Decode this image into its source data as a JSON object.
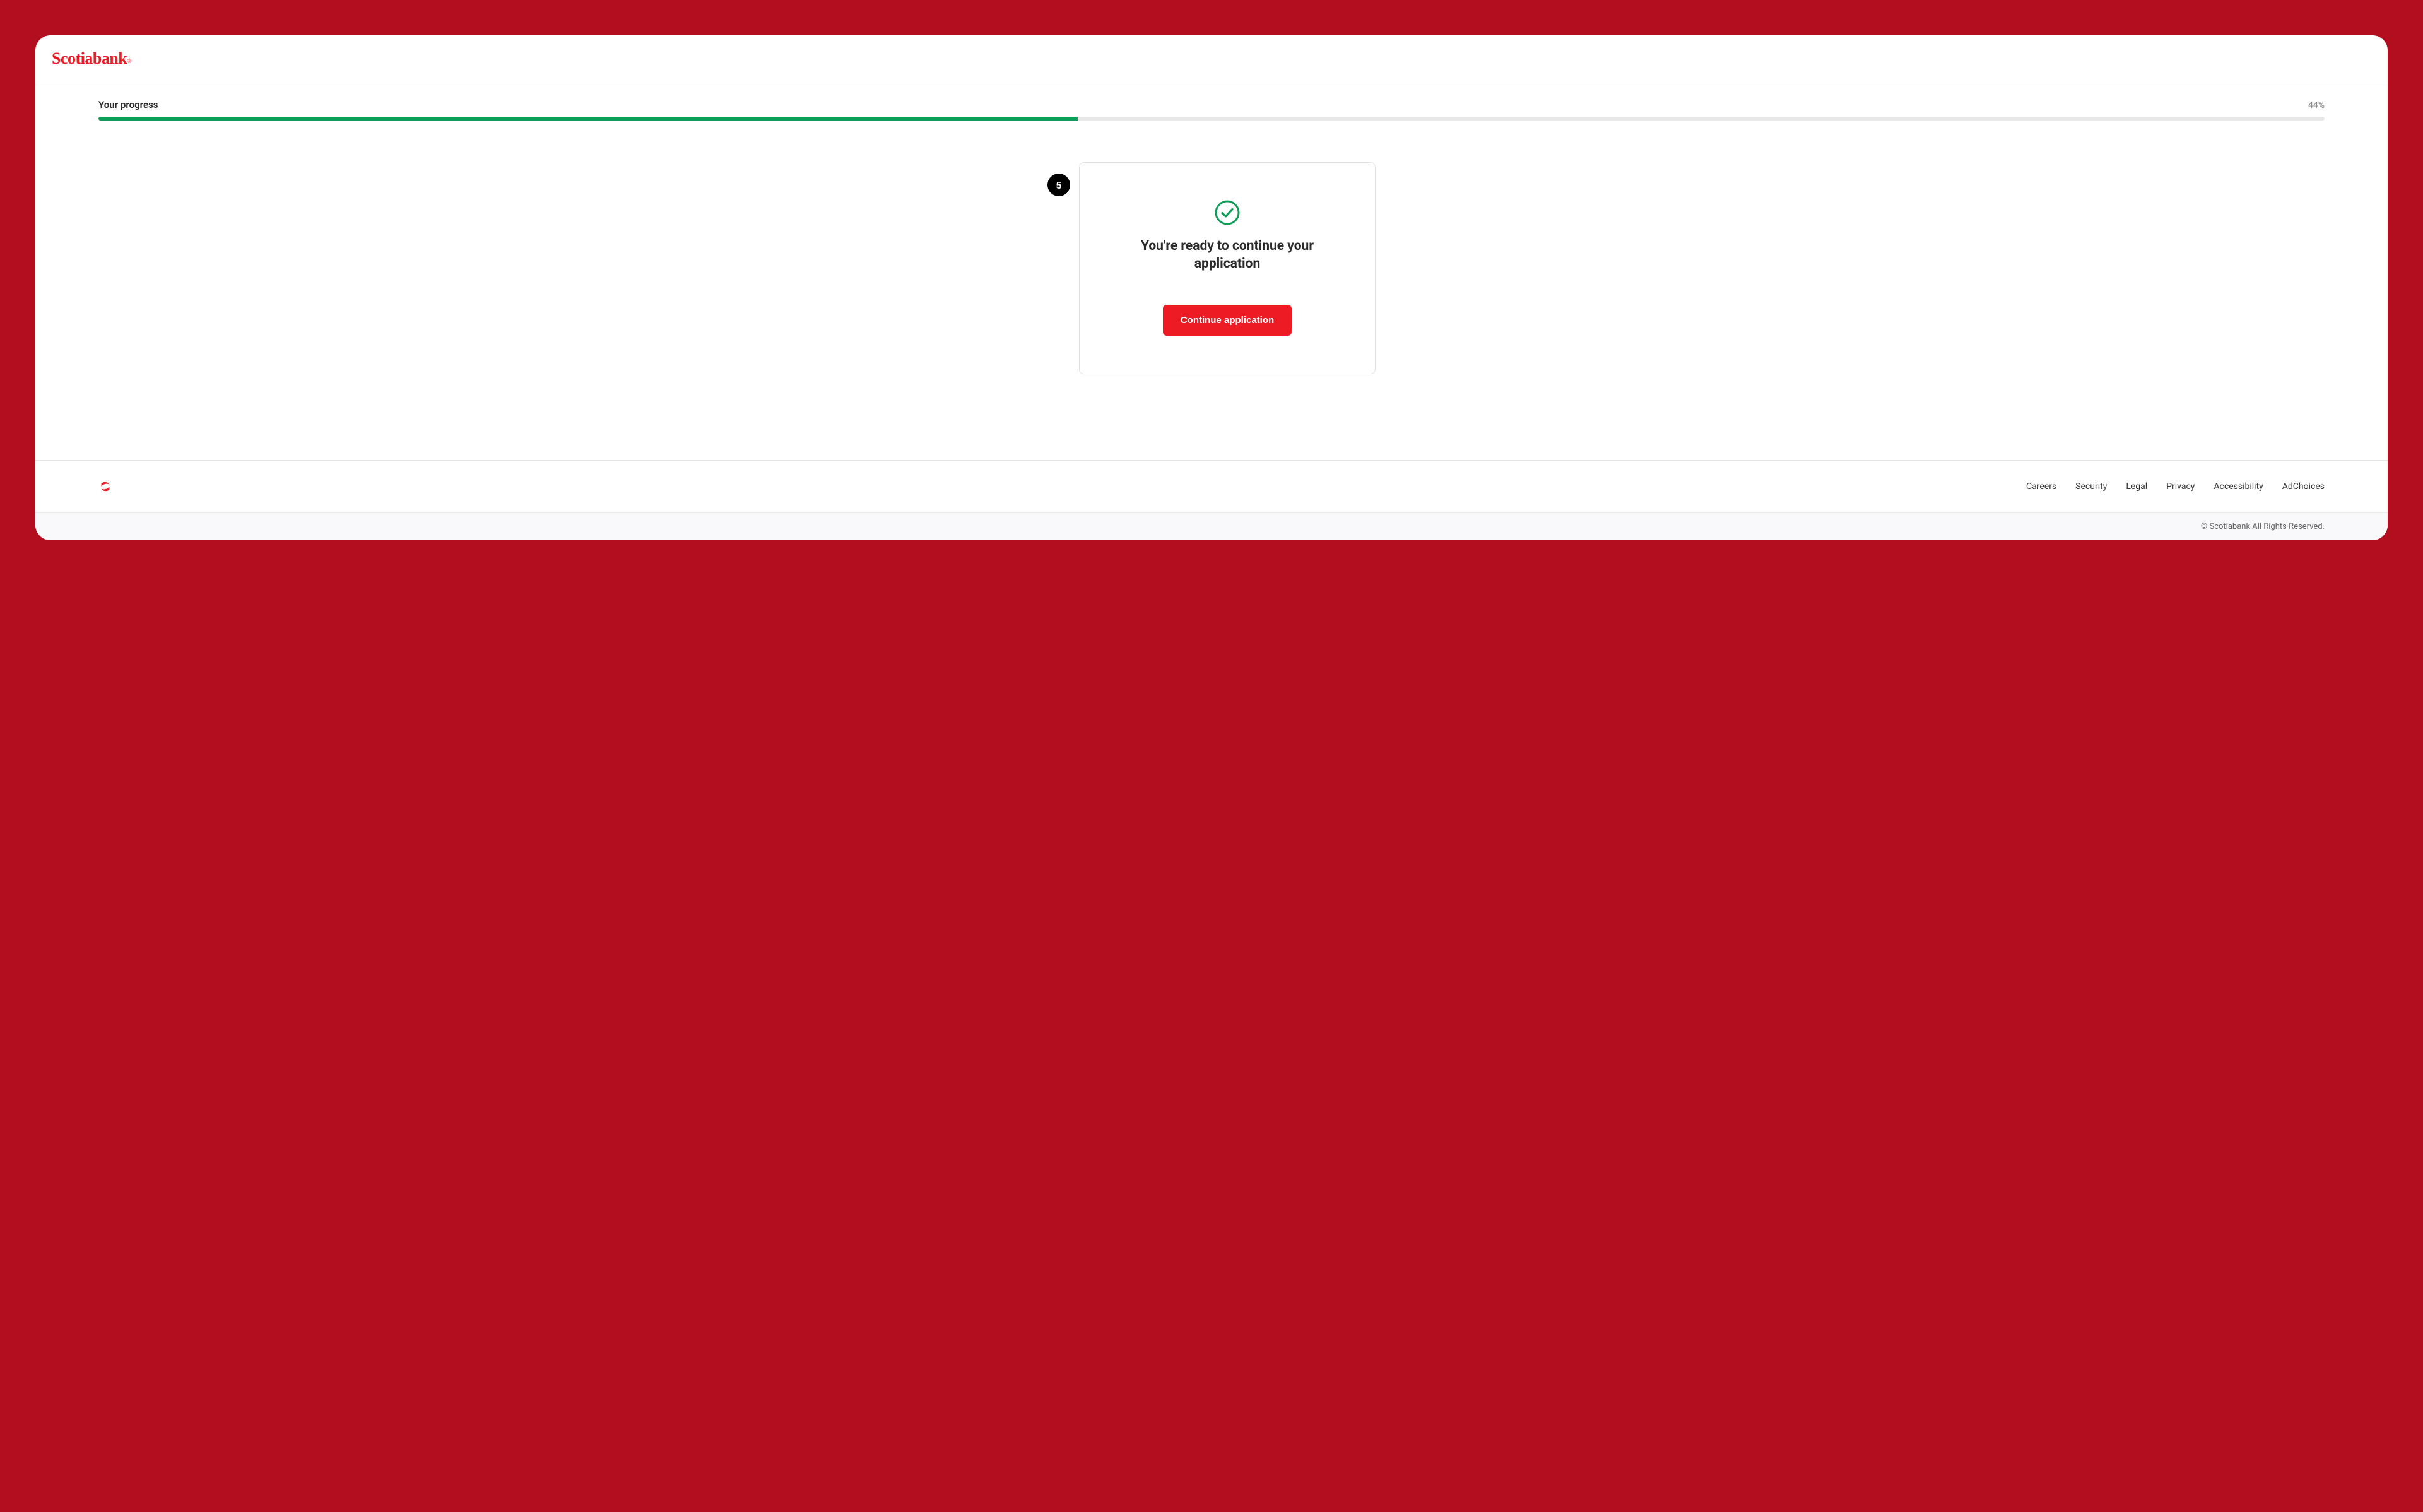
{
  "header": {
    "logo_text": "Scotiabank",
    "logo_reg": "®"
  },
  "progress": {
    "label": "Your progress",
    "percent_text": "44%",
    "percent_value": 44
  },
  "step": {
    "number": "5",
    "heading": "You're ready to continue your application",
    "button_label": "Continue application"
  },
  "footer": {
    "links": [
      "Careers",
      "Security",
      "Legal",
      "Privacy",
      "Accessibility",
      "AdChoices"
    ],
    "copyright": "© Scotiabank All Rights Reserved."
  },
  "colors": {
    "brand_red": "#ed1c24",
    "progress_green": "#0f9d58",
    "bg_red": "#b30e1f"
  }
}
